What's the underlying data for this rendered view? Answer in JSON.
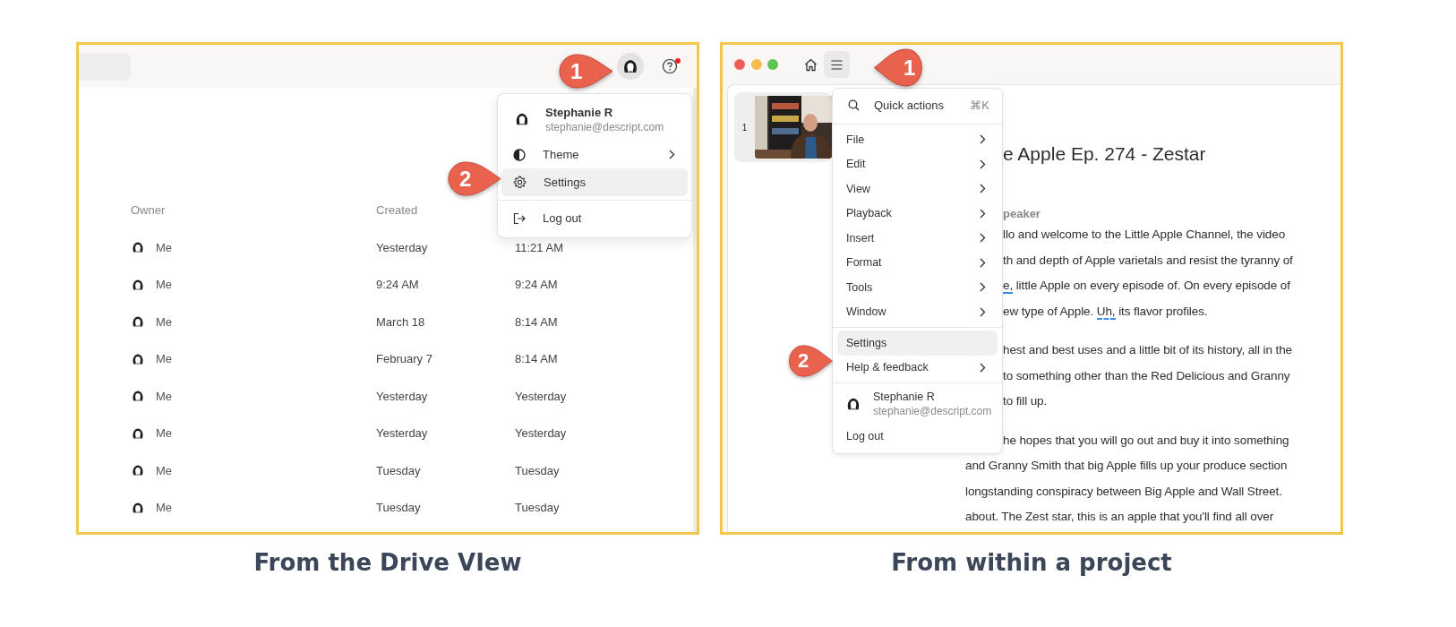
{
  "drive_view": {
    "help": {
      "notification": true
    },
    "step_markers": [
      {
        "number": "1"
      },
      {
        "number": "2"
      }
    ],
    "account_menu": {
      "user": {
        "name": "Stephanie R",
        "email": "stephanie@descript.com"
      },
      "items": [
        {
          "kind": "theme",
          "label": "Theme",
          "submenu": true,
          "selected": false
        },
        {
          "kind": "settings",
          "label": "Settings",
          "submenu": false,
          "selected": true
        },
        {
          "kind": "logout",
          "label": "Log out",
          "submenu": false,
          "selected": false
        }
      ]
    },
    "table": {
      "columns": [
        "Owner",
        "Created"
      ],
      "rows": [
        {
          "owner": "Me",
          "created": "Yesterday",
          "column_3": "11:21 AM"
        },
        {
          "owner": "Me",
          "created": "9:24 AM",
          "column_3": "9:24 AM"
        },
        {
          "owner": "Me",
          "created": "March 18",
          "column_3": "8:14 AM"
        },
        {
          "owner": "Me",
          "created": "February 7",
          "column_3": "8:14 AM"
        },
        {
          "owner": "Me",
          "created": "Yesterday",
          "column_3": "Yesterday"
        },
        {
          "owner": "Me",
          "created": "Yesterday",
          "column_3": "Yesterday"
        },
        {
          "owner": "Me",
          "created": "Tuesday",
          "column_3": "Tuesday"
        },
        {
          "owner": "Me",
          "created": "Tuesday",
          "column_3": "Tuesday"
        }
      ]
    }
  },
  "project_view": {
    "menu_button": {
      "open": true
    },
    "step_markers": [
      {
        "number": "1"
      },
      {
        "number": "2"
      }
    ],
    "clips": [
      {
        "number": "1",
        "kind": "picture"
      }
    ],
    "main_menu": {
      "quick_action": {
        "label": "Quick actions",
        "shortcut": "⌘K"
      },
      "sections": [
        [
          {
            "label": "File",
            "submenu": true,
            "selected": false
          },
          {
            "label": "Edit",
            "submenu": true,
            "selected": false
          },
          {
            "label": "View",
            "submenu": true,
            "selected": false
          },
          {
            "label": "Playback",
            "submenu": true,
            "selected": false
          },
          {
            "label": "Insert",
            "submenu": true,
            "selected": false
          },
          {
            "label": "Format",
            "submenu": true,
            "selected": false
          },
          {
            "label": "Tools",
            "submenu": true,
            "selected": false
          },
          {
            "label": "Window",
            "submenu": true,
            "selected": false
          }
        ],
        [
          {
            "label": "Settings",
            "submenu": false,
            "selected": true
          },
          {
            "label": "Help & feedback",
            "submenu": true,
            "selected": false
          }
        ]
      ],
      "user": {
        "name": "Stephanie R",
        "email": "stephanie@descript.com"
      },
      "logout": "Log out"
    },
    "editor": {
      "title": "e Apple Ep. 274 - Zestar",
      "speaker": "peaker",
      "paragraphs": [
        {
          "lines": [
            {
              "kind": "beside_menu",
              "segments": [
                {
                  "text": "llo and welcome to the Little Apple Channel, the video",
                  "flagged": false
                }
              ]
            },
            {
              "kind": "beside_menu",
              "segments": [
                {
                  "text": "th and depth of Apple varietals and resist the tyranny of",
                  "flagged": false
                }
              ]
            },
            {
              "kind": "beside_menu",
              "segments": [
                {
                  "text": "e,",
                  "flagged": true
                },
                {
                  "text": " little Apple on every episode of. On every episode of",
                  "flagged": false
                }
              ]
            },
            {
              "kind": "beside_menu",
              "segments": [
                {
                  "text": "ew type of Apple. ",
                  "flagged": false
                },
                {
                  "text": "Uh,",
                  "flagged": true
                },
                {
                  "text": " its flavor profiles.",
                  "flagged": false
                }
              ]
            }
          ]
        },
        {
          "lines": [
            {
              "kind": "beside_menu",
              "segments": [
                {
                  "text": "hest and best uses and a little bit of its history, all in the",
                  "flagged": false
                }
              ]
            },
            {
              "kind": "beside_menu",
              "segments": [
                {
                  "text": "to something other than the Red Delicious and Granny",
                  "flagged": false
                }
              ]
            },
            {
              "kind": "beside_menu",
              "segments": [
                {
                  "text": "to fill up.",
                  "flagged": false
                }
              ]
            }
          ]
        },
        {
          "lines": [
            {
              "kind": "beside_menu",
              "segments": [
                {
                  "text": "he hopes that you will go out and buy it into something",
                  "flagged": false
                }
              ]
            },
            {
              "kind": "full",
              "segments": [
                {
                  "text": "and Granny Smith that big Apple fills up your produce section",
                  "flagged": false
                }
              ]
            },
            {
              "kind": "full",
              "segments": [
                {
                  "text": "longstanding conspiracy between Big Apple and Wall Street.",
                  "flagged": false
                }
              ]
            },
            {
              "kind": "full",
              "segments": [
                {
                  "text": "about. The Zest star, this is an apple that you'll find all over",
                  "flagged": false
                }
              ]
            }
          ]
        }
      ]
    }
  },
  "captions": [
    "From the Drive VIew",
    "From within a project"
  ]
}
